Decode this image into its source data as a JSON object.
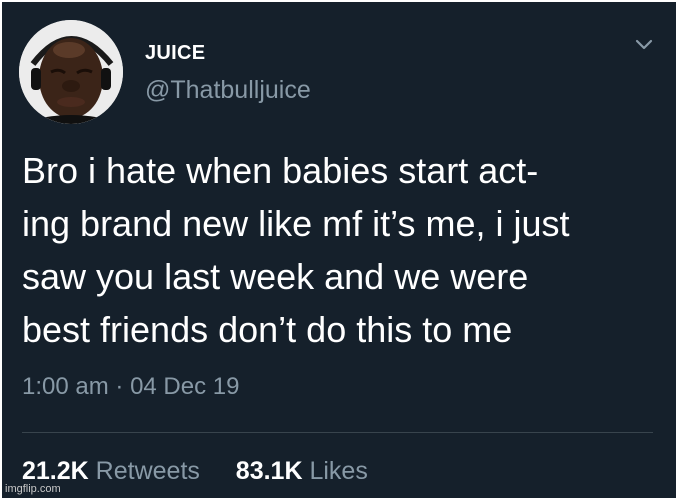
{
  "tweet": {
    "display_name": "JUICE",
    "handle": "@Thatbulljuice",
    "text": "Bro i hate when babies start act-\ning brand new like mf it’s me, i just\nsaw you last week and we were\nbest friends don’t do this to me",
    "time": "1:00 am",
    "separator": "·",
    "date": "04 Dec 19",
    "retweets_count": "21.2K",
    "retweets_label": "Retweets",
    "likes_count": "83.1K",
    "likes_label": "Likes"
  },
  "watermark": "imgflip.com",
  "icons": {
    "avatar": "profile-photo",
    "menu": "chevron-down-icon"
  },
  "colors": {
    "background": "#15202b",
    "text_primary": "#ffffff",
    "text_secondary": "#8899a6",
    "divider": "#38444d"
  }
}
